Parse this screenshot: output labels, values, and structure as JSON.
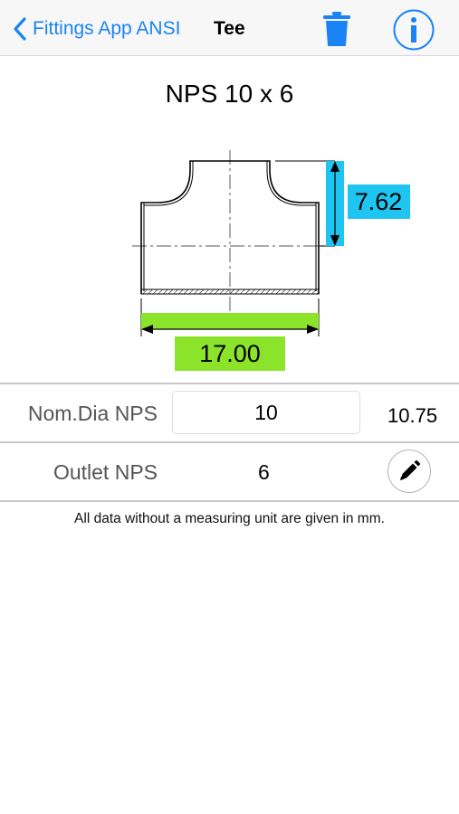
{
  "nav": {
    "back_label": "Fittings App ANSI",
    "title": "Tee",
    "back_icon": "chevron-left-icon",
    "delete_icon": "trash-icon",
    "info_icon": "info-icon"
  },
  "header": {
    "title": "NPS 10 x 6"
  },
  "drawing": {
    "height_dim": "7.62",
    "width_dim": "17.00",
    "colors": {
      "height_box": "#1ec5f0",
      "width_box": "#8be42a"
    }
  },
  "rows": {
    "nom_dia": {
      "label": "Nom.Dia NPS",
      "value": "10",
      "od": "10.75"
    },
    "outlet": {
      "label": "Outlet NPS",
      "value": "6",
      "edit_icon": "pencil-icon"
    }
  },
  "footnote": "All data without a measuring unit are given in mm.",
  "colors": {
    "accent": "#1a83f5"
  }
}
